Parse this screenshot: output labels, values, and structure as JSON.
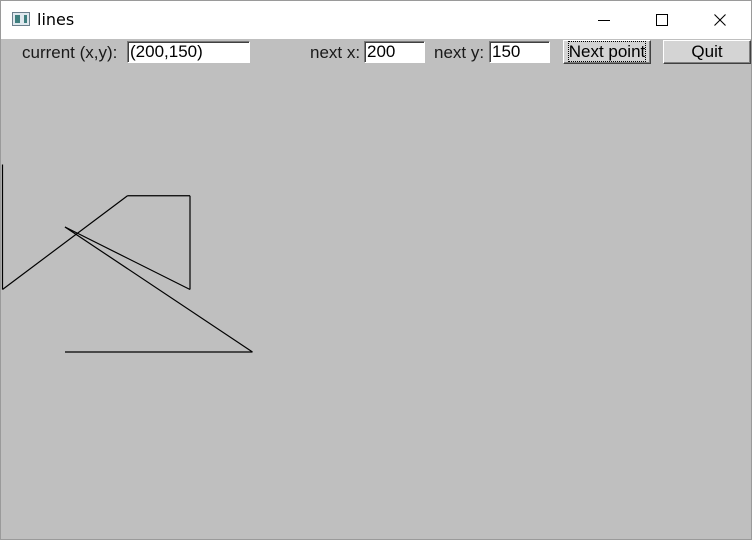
{
  "window": {
    "title": "lines",
    "controls": [
      "minimize-icon",
      "maximize-icon",
      "close-icon"
    ]
  },
  "toolbar": {
    "current_label": "current (x,y):",
    "current_value": "(200,150)",
    "next_x_label": "next x:",
    "next_x_value": "200",
    "next_y_label": "next y:",
    "next_y_value": "150",
    "next_point_label": "Next point",
    "quit_label": "Quit"
  },
  "drawing": {
    "line_color": "#000000",
    "background_color": "#bfbfbf",
    "points": [
      [
        0,
        0
      ],
      [
        300,
        0
      ],
      [
        0,
        200
      ],
      [
        200,
        100
      ],
      [
        200,
        250
      ],
      [
        100,
        250
      ],
      [
        -100,
        100
      ],
      [
        -100,
        300
      ]
    ]
  }
}
